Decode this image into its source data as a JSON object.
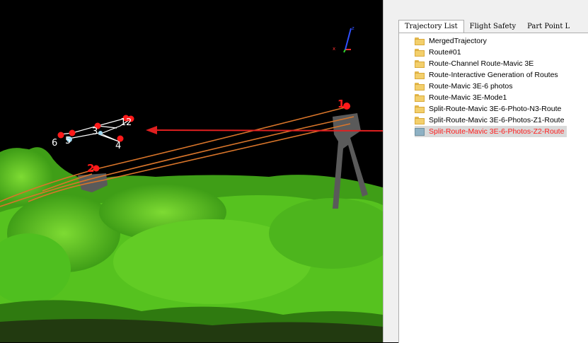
{
  "tabs": [
    {
      "label": "Trajectory List",
      "active": true
    },
    {
      "label": "Flight Safety",
      "active": false
    },
    {
      "label": "Part Point L",
      "active": false
    }
  ],
  "tree_items": [
    {
      "label": "MergedTrajectory",
      "icon": "folder-icon",
      "selected": false
    },
    {
      "label": "Route#01",
      "icon": "folder-icon",
      "selected": false
    },
    {
      "label": "Route-Channel Route-Mavic 3E",
      "icon": "folder-icon",
      "selected": false
    },
    {
      "label": "Route-Interactive Generation of Routes",
      "icon": "folder-icon",
      "selected": false
    },
    {
      "label": "Route-Mavic 3E-6 photos",
      "icon": "folder-icon",
      "selected": false
    },
    {
      "label": "Route-Mavic 3E-Mode1",
      "icon": "folder-icon",
      "selected": false
    },
    {
      "label": "Split-Route-Mavic 3E-6-Photo-N3-Route",
      "icon": "folder-icon",
      "selected": false
    },
    {
      "label": "Split-Route-Mavic 3E-6-Photos-Z1-Route",
      "icon": "folder-icon",
      "selected": false
    },
    {
      "label": "Split-Route-Mavic 3E-6-Photos-Z2-Route",
      "icon": "route-icon",
      "selected": true
    }
  ],
  "waypoint_labels": [
    "1",
    "2",
    "3",
    "4",
    "5",
    "6",
    "1",
    "2"
  ],
  "colors": {
    "vegetation": "#4fbf1f",
    "vegetation_light": "#8fe83a",
    "power_line": "#d9752a",
    "waypoint": "#ff1a1a",
    "route_line": "#ffffff",
    "arrow": "#e02020",
    "selected_text": "#ff1a1a"
  }
}
